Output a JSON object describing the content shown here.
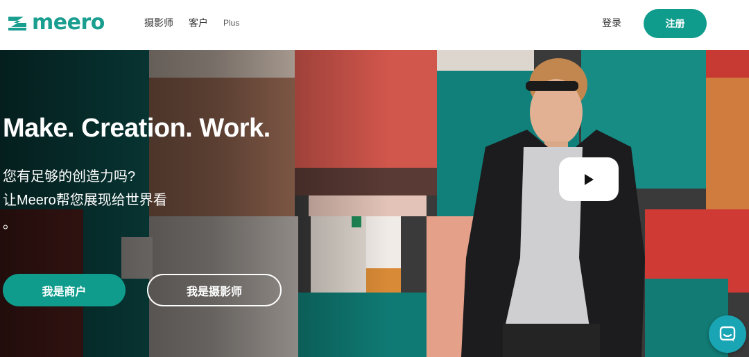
{
  "header": {
    "logo_text": "meero",
    "nav": [
      {
        "label": "摄影师"
      },
      {
        "label": "客户"
      },
      {
        "label": "Plus"
      }
    ],
    "login_label": "登录",
    "signup_label": "注册"
  },
  "hero": {
    "title": "Make. Creation. Work.",
    "subtitle_line1": "您有足够的创造力吗?",
    "subtitle_line2": "让Meero帮您展现给世界看",
    "subtitle_line3": "。",
    "buttons": {
      "merchant_label": "我是商户",
      "photographer_label": "我是摄影师"
    },
    "play_icon": "play-icon"
  },
  "chat": {
    "icon": "chat-bubble-icon"
  },
  "colors": {
    "brand": "#0f9c8c",
    "chat": "#1aa5b4"
  }
}
